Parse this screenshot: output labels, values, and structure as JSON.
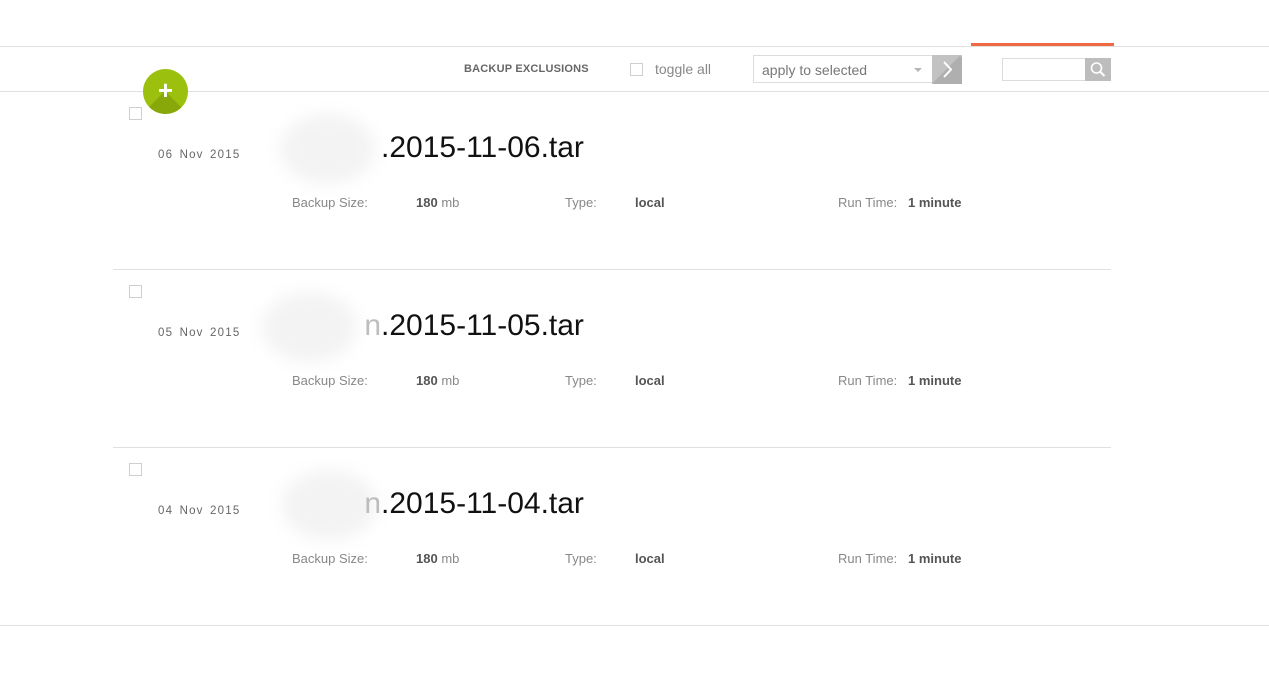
{
  "colors": {
    "accent": "#ef6a43",
    "fab": "#9cc00e"
  },
  "toolbar": {
    "exclusions_label": "BACKUP EXCLUSIONS",
    "toggle_all_label": "toggle all",
    "bulk_action": {
      "selected": "apply to selected"
    },
    "search_placeholder": ""
  },
  "add_button": {
    "label": "+"
  },
  "labels": {
    "size": "Backup Size:",
    "type": "Type:",
    "runtime": "Run Time:"
  },
  "backups": [
    {
      "date": "06 Nov 2015",
      "name_hidden": "",
      "name": ".2015-11-06.tar",
      "size": "180",
      "size_unit": "mb",
      "type": "local",
      "runtime": "1 minute"
    },
    {
      "date": "05 Nov 2015",
      "name_hidden": "n",
      "name": ".2015-11-05.tar",
      "size": "180",
      "size_unit": "mb",
      "type": "local",
      "runtime": "1 minute"
    },
    {
      "date": "04 Nov 2015",
      "name_hidden": "n",
      "name": ".2015-11-04.tar",
      "size": "180",
      "size_unit": "mb",
      "type": "local",
      "runtime": "1 minute"
    }
  ]
}
